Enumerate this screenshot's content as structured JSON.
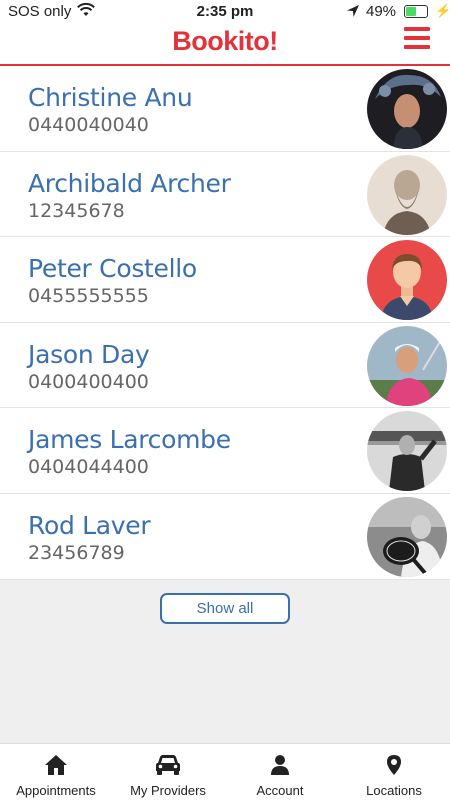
{
  "status_bar": {
    "carrier": "SOS only",
    "time": "2:35 pm",
    "battery_pct": "49%",
    "battery_level": 0.49,
    "charging_icon": "bolt-icon"
  },
  "header": {
    "logo": "Bookito!",
    "menu_icon": "hamburger-menu-icon"
  },
  "providers": [
    {
      "name": "Christine Anu",
      "phone": "0440040040"
    },
    {
      "name": "Archibald Archer",
      "phone": "12345678"
    },
    {
      "name": "Peter Costello",
      "phone": "0455555555"
    },
    {
      "name": "Jason Day",
      "phone": "0400400400"
    },
    {
      "name": "James Larcombe",
      "phone": "0404044400"
    },
    {
      "name": "Rod Laver",
      "phone": "23456789"
    }
  ],
  "show_all_label": "Show all",
  "tabs": [
    {
      "label": "Appointments",
      "icon": "home-icon"
    },
    {
      "label": "My Providers",
      "icon": "car-icon"
    },
    {
      "label": "Account",
      "icon": "person-icon"
    },
    {
      "label": "Locations",
      "icon": "map-pin-icon"
    }
  ],
  "colors": {
    "brand": "#e4323a",
    "link": "#3a6fb0"
  }
}
